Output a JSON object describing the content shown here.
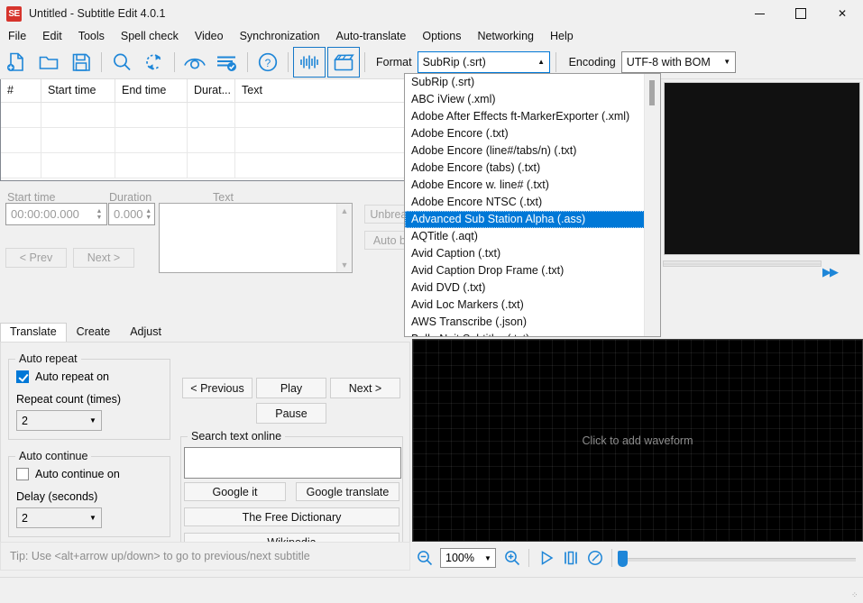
{
  "window": {
    "title": "Untitled - Subtitle Edit 4.0.1",
    "logo_text": "SE",
    "minimize": "—",
    "maximize": "□",
    "close": "✕"
  },
  "menubar": {
    "items": [
      {
        "label": "File"
      },
      {
        "label": "Edit"
      },
      {
        "label": "Tools"
      },
      {
        "label": "Spell check"
      },
      {
        "label": "Video"
      },
      {
        "label": "Synchronization"
      },
      {
        "label": "Auto-translate"
      },
      {
        "label": "Options"
      },
      {
        "label": "Networking"
      },
      {
        "label": "Help"
      }
    ]
  },
  "toolbar": {
    "buttons": [
      {
        "name": "new-file-icon",
        "tip": "New"
      },
      {
        "name": "open-folder-icon",
        "tip": "Open"
      },
      {
        "name": "save-icon",
        "tip": "Save"
      },
      {
        "name": "search-icon",
        "tip": "Find"
      },
      {
        "name": "replace-icon",
        "tip": "Replace"
      },
      {
        "name": "visual-sync-icon",
        "tip": "Visual sync"
      },
      {
        "name": "spell-check-icon",
        "tip": "Spell check"
      },
      {
        "name": "help-icon",
        "tip": "Help"
      },
      {
        "name": "waveform-icon",
        "tip": "Toggle waveform"
      },
      {
        "name": "video-icon",
        "tip": "Toggle video"
      }
    ],
    "format_label": "Format",
    "format_value": "SubRip (.srt)",
    "encoding_label": "Encoding",
    "encoding_value": "UTF-8 with BOM",
    "arrow_up": "▲",
    "arrow_down": "▼"
  },
  "format_dropdown": {
    "open": true,
    "selected": "Advanced Sub Station Alpha (.ass)",
    "items": [
      "SubRip (.srt)",
      "ABC iView (.xml)",
      "Adobe After Effects ft-MarkerExporter (.xml)",
      "Adobe Encore (.txt)",
      "Adobe Encore (line#/tabs/n) (.txt)",
      "Adobe Encore (tabs) (.txt)",
      "Adobe Encore w. line# (.txt)",
      "Adobe Encore NTSC (.txt)",
      "Advanced Sub Station Alpha (.ass)",
      "AQTitle (.aqt)",
      "Avid Caption (.txt)",
      "Avid Caption Drop Frame (.txt)",
      "Avid DVD (.txt)",
      "Avid Loc Markers (.txt)",
      "AWS Transcribe (.json)",
      "Belle Nuit Subtitler (.txt)"
    ]
  },
  "subtitle_list": {
    "columns": [
      "#",
      "Start time",
      "End time",
      "Durat...",
      "Text"
    ],
    "rows": []
  },
  "edit_panel": {
    "start_time_label": "Start time",
    "start_time_value": "00:00:00.000",
    "duration_label": "Duration",
    "duration_value": "0.000",
    "text_label": "Text",
    "text_value": "",
    "prev_label": "< Prev",
    "next_label": "Next >",
    "unbreak_label": "Unbreak",
    "autobr_label": "Auto br",
    "spin_up": "▲",
    "spin_down": "▼",
    "scroll_up": "▲",
    "scroll_down": "▼"
  },
  "tabs": {
    "items": [
      "Translate",
      "Create",
      "Adjust"
    ],
    "selected": "Translate"
  },
  "translate_tab": {
    "auto_repeat_group": "Auto repeat",
    "auto_repeat_checkbox": "Auto repeat on",
    "auto_repeat_checked": true,
    "repeat_count_label": "Repeat count (times)",
    "repeat_count_value": "2",
    "auto_continue_group": "Auto continue",
    "auto_continue_checkbox": "Auto continue on",
    "auto_continue_checked": false,
    "delay_label": "Delay (seconds)",
    "delay_value": "2",
    "previous_label": "< Previous",
    "play_label": "Play",
    "next_label": "Next >",
    "pause_label": "Pause",
    "search_group": "Search text online",
    "search_value": "",
    "google_it_label": "Google it",
    "google_translate_label": "Google translate",
    "free_dictionary_label": "The Free Dictionary",
    "wikipedia_label": "Wikipedia",
    "tip": "Tip: Use <alt+arrow up/down> to go to previous/next subtitle",
    "dropdown_arrow": "▼"
  },
  "video": {
    "fast_forward_icon": "▶▶"
  },
  "waveform": {
    "hint": "Click to add waveform",
    "zoom_value": "100%",
    "zoom_arrow": "▼",
    "buttons": [
      {
        "name": "zoom-out-icon"
      },
      {
        "name": "zoom-in-icon"
      },
      {
        "name": "play-icon"
      },
      {
        "name": "set-start-icon"
      },
      {
        "name": "playback-speed-icon"
      }
    ]
  },
  "colors": {
    "accent": "#1e86d8",
    "selection": "#0078d7",
    "window_bg": "#f0f0f0",
    "logo_red": "#d6342c"
  }
}
